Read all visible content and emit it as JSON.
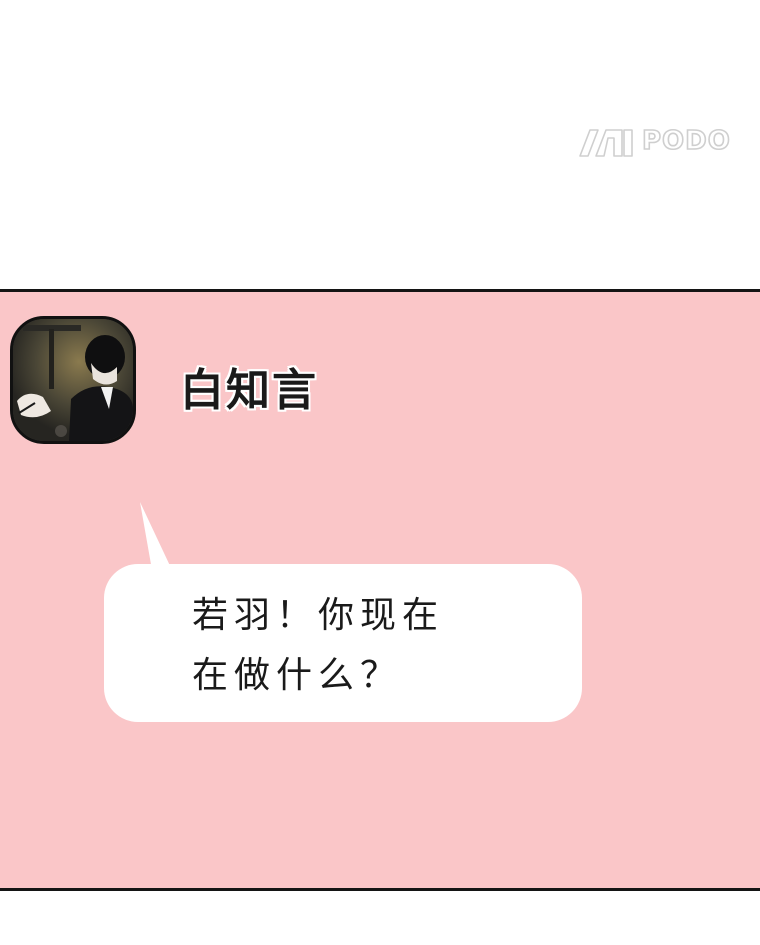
{
  "watermark": {
    "text": "PODO"
  },
  "chat": {
    "background_color": "#fac6c8",
    "sender_name": "白知言",
    "message_line1": "若羽！你现在",
    "message_line2": "在做什么？"
  }
}
